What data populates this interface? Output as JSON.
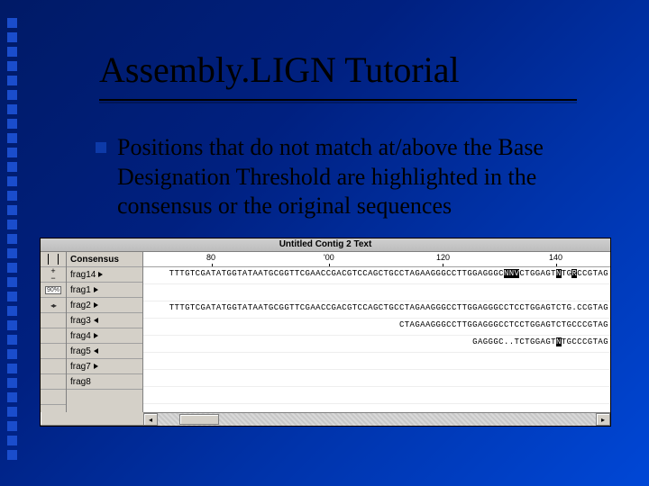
{
  "title": "Assembly.LIGN Tutorial",
  "bullet_text": "Positions that do not match at/above the Base Designation Threshold are highlighted in the consensus or the original sequences",
  "window": {
    "titlebar": "Untitled Contig 2 Text",
    "ruler": {
      "t80": "80",
      "t100": "'00",
      "t120": "120",
      "t140": "140"
    },
    "icons": {
      "pct": "90%"
    },
    "tracks": [
      {
        "name": "Consensus",
        "bold": true,
        "dir": "none",
        "seq_pre": "TTTGTCGATATGGTATAATGCGGTTCGAACCGACGTCCAGCTGCCTAGAAGGGCCTTGGAGGGC",
        "hl1": "NNV",
        "mid1": "CTGGAGT",
        "hl2": "N",
        "mid2": "TG",
        "hl3": "R",
        "post": "CCGTAG"
      },
      {
        "name": "frag14",
        "bold": false,
        "dir": "right",
        "seq_plain": ""
      },
      {
        "name": "frag1",
        "bold": false,
        "dir": "right",
        "seq_plain": "TTTGTCGATATGGTATAATGCGGTTCGAACCGACGTCCAGCTGCCTAGAAGGGCCTTGGAGGGCCTCCTGGAGTCTG.CCGTAG"
      },
      {
        "name": "frag2",
        "bold": false,
        "dir": "right",
        "seq_plain": "CTAGAAGGGCCTTGGAGGGCCTCCTGGAGTCTGCCCGTAG"
      },
      {
        "name": "frag3",
        "bold": false,
        "dir": "left",
        "seq_pre": "GAGGGC..TCTGGAGT",
        "hl1": "N",
        "mid1": "TGCCCGTAG",
        "hl2": "",
        "mid2": "",
        "hl3": "",
        "post": ""
      },
      {
        "name": "frag4",
        "bold": false,
        "dir": "right",
        "seq_plain": ""
      },
      {
        "name": "frag5",
        "bold": false,
        "dir": "left",
        "seq_plain": ""
      },
      {
        "name": "frag7",
        "bold": false,
        "dir": "right",
        "seq_plain": ""
      },
      {
        "name": "frag8",
        "bold": false,
        "dir": "none",
        "seq_plain": ""
      }
    ]
  }
}
